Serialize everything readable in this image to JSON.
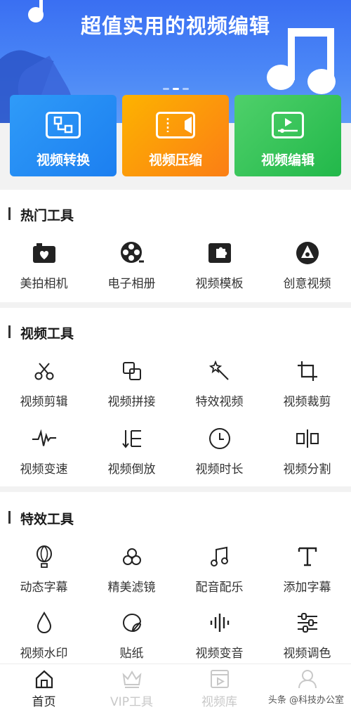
{
  "banner": {
    "title": "超值实用的视频编辑",
    "colors": {
      "top": "#3a6ff2",
      "bottom": "#5d9af7"
    }
  },
  "cards": [
    {
      "label": "视频转换",
      "icon": "convert-icon",
      "color": "#2f9bf8"
    },
    {
      "label": "视频压缩",
      "icon": "compress-icon",
      "color": "#fc9a0b"
    },
    {
      "label": "视频编辑",
      "icon": "edit-video-icon",
      "color": "#3ec55c"
    }
  ],
  "hot_tools": {
    "title": "热门工具",
    "items": [
      {
        "label": "美拍相机",
        "icon": "camera-heart-icon"
      },
      {
        "label": "电子相册",
        "icon": "film-reel-icon"
      },
      {
        "label": "视频模板",
        "icon": "puzzle-icon"
      },
      {
        "label": "创意视频",
        "icon": "creative-icon"
      }
    ]
  },
  "video_tools": {
    "title": "视频工具",
    "items": [
      {
        "label": "视频剪辑",
        "icon": "scissors-icon"
      },
      {
        "label": "视频拼接",
        "icon": "merge-icon"
      },
      {
        "label": "特效视频",
        "icon": "magic-wand-icon"
      },
      {
        "label": "视频裁剪",
        "icon": "crop-icon"
      },
      {
        "label": "视频变速",
        "icon": "waveform-icon"
      },
      {
        "label": "视频倒放",
        "icon": "reverse-icon"
      },
      {
        "label": "视频时长",
        "icon": "clock-icon"
      },
      {
        "label": "视频分割",
        "icon": "split-icon"
      }
    ]
  },
  "effect_tools": {
    "title": "特效工具",
    "items": [
      {
        "label": "动态字幕",
        "icon": "balloon-icon"
      },
      {
        "label": "精美滤镜",
        "icon": "filter-icon"
      },
      {
        "label": "配音配乐",
        "icon": "music-note-icon"
      },
      {
        "label": "添加字幕",
        "icon": "text-icon"
      },
      {
        "label": "视频水印",
        "icon": "drop-icon"
      },
      {
        "label": "贴纸",
        "icon": "sticker-icon"
      },
      {
        "label": "视频变音",
        "icon": "voice-icon"
      },
      {
        "label": "视频调色",
        "icon": "sliders-icon"
      }
    ]
  },
  "bottom_nav": [
    {
      "label": "首页",
      "icon": "home-icon",
      "active": true
    },
    {
      "label": "VIP工具",
      "icon": "crown-icon",
      "active": false
    },
    {
      "label": "视频库",
      "icon": "video-library-icon",
      "active": false
    },
    {
      "label": "",
      "icon": "profile-icon",
      "active": false
    }
  ],
  "watermark": "头条 @科技办公室"
}
